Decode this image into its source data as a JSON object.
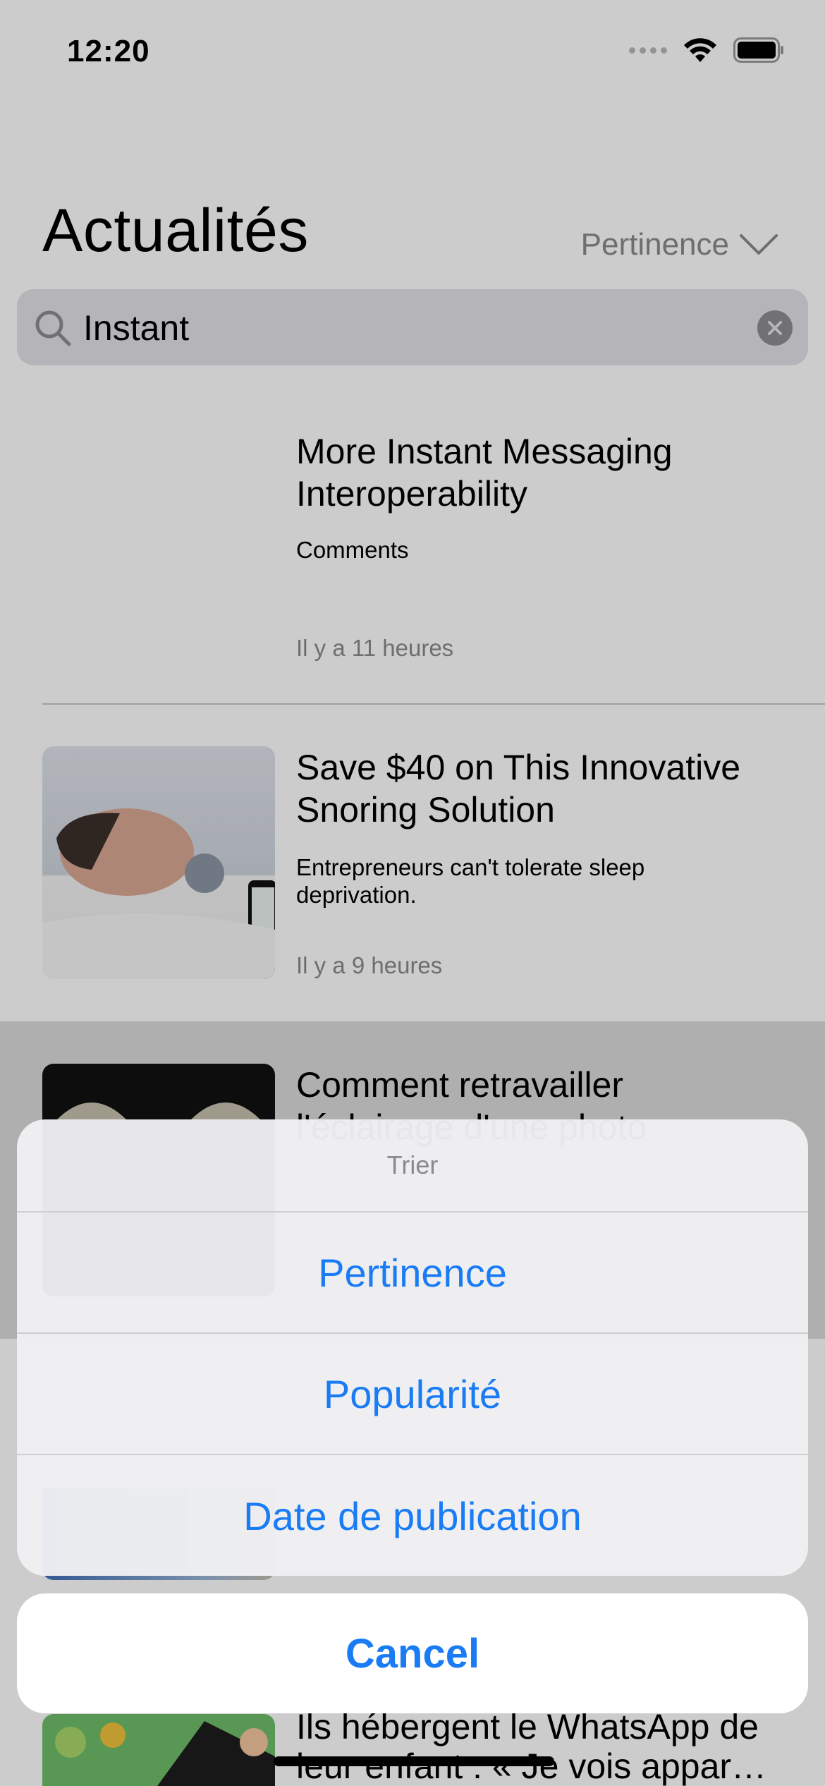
{
  "status_bar": {
    "time": "12:20"
  },
  "header": {
    "title": "Actualités",
    "sort_label": "Pertinence"
  },
  "search": {
    "value": "Instant"
  },
  "articles": [
    {
      "title": "More Instant Messaging Interoperability",
      "description": "Comments",
      "time": "Il y a 11 heures"
    },
    {
      "title": "Save $40 on This Innovative Snoring Solution",
      "description": "Entrepreneurs can't tolerate sleep deprivation.",
      "time": "Il y a 9 heures"
    },
    {
      "title": "Comment retravailler l'éclairage d'une photo",
      "description": "",
      "time": ""
    },
    {
      "title": "Ils hébergent le WhatsApp de leur enfant : « Je vois appar…",
      "description": "",
      "time": ""
    }
  ],
  "action_sheet": {
    "title": "Trier",
    "options": [
      "Pertinence",
      "Popularité",
      "Date de publication"
    ],
    "cancel_label": "Cancel"
  },
  "colors": {
    "accent": "#1a7cf5",
    "secondary_text": "#8a8a8e",
    "sheet_bg": "#f0f0f2"
  }
}
